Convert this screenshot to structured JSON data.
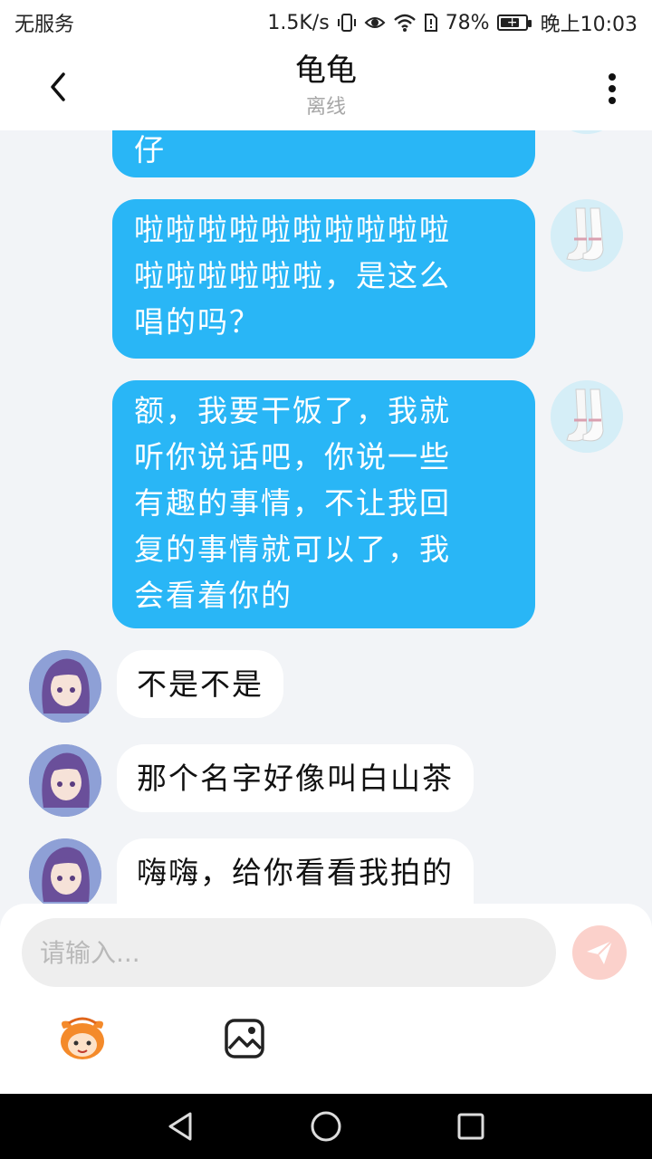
{
  "status_bar": {
    "carrier": "无服务",
    "network_speed": "1.5K/s",
    "battery_percent": "78%",
    "battery_level": 0.78,
    "time": "晚上10:03",
    "icons": [
      "vibrate-icon",
      "eye-icon",
      "wifi-icon",
      "sim-icon",
      "battery-charging-icon"
    ]
  },
  "header": {
    "title": "龟龟",
    "subtitle": "离线",
    "back_icon": "chevron-left-icon",
    "more_icon": "more-vertical-icon"
  },
  "messages": [
    {
      "side": "right",
      "lines": [
        "仔"
      ]
    },
    {
      "side": "right",
      "lines": [
        "啦啦啦啦啦啦啦啦啦啦",
        "啦啦啦啦啦啦，是这么",
        "唱的吗？"
      ]
    },
    {
      "side": "right",
      "lines": [
        "额，我要干饭了，我就",
        "听你说话吧，你说一些",
        "有趣的事情，不让我回",
        "复的事情就可以了，我",
        "会看着你的"
      ]
    },
    {
      "side": "left",
      "lines": [
        "不是不是"
      ]
    },
    {
      "side": "left",
      "lines": [
        "那个名字好像叫白山茶"
      ]
    },
    {
      "side": "left",
      "lines": [
        "嗨嗨，给你看看我拍的"
      ]
    }
  ],
  "input": {
    "placeholder": "请输入...",
    "send_icon": "send-icon",
    "emoji_icon": "emoji-mascot-icon",
    "image_icon": "image-icon"
  },
  "nav": {
    "back_icon": "nav-back-icon",
    "home_icon": "nav-home-icon",
    "recents_icon": "nav-recents-icon"
  },
  "colors": {
    "bubble_right": "#29b6f6",
    "bubble_left": "#ffffff",
    "background": "#f2f4f7",
    "send_button": "#fbd1cb",
    "subtitle": "#a6a6a6"
  }
}
